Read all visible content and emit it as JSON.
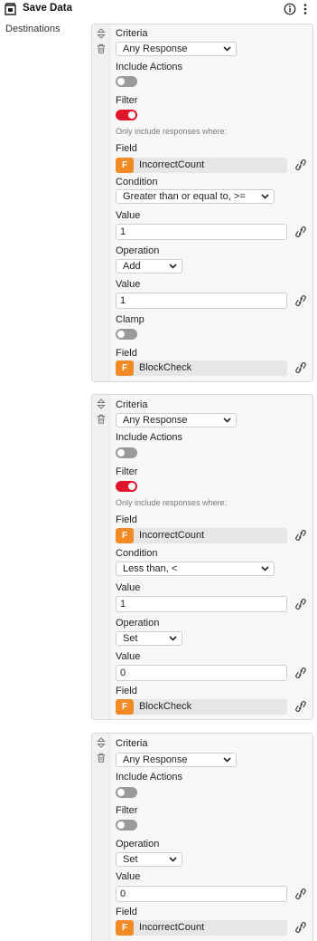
{
  "header": {
    "title": "Save Data",
    "icons": [
      "save-icon",
      "info-icon",
      "more-icon"
    ]
  },
  "destinations_label": "Destinations",
  "labels": {
    "criteria": "Criteria",
    "include_actions": "Include Actions",
    "filter": "Filter",
    "filter_hint": "Only include responses where:",
    "field": "Field",
    "condition": "Condition",
    "value": "Value",
    "operation": "Operation",
    "clamp": "Clamp",
    "field_badge": "F"
  },
  "colors": {
    "accent": "#e0142b",
    "field_badge": "#f28a26",
    "toggle_off": "#9a9a9a"
  },
  "cards": [
    {
      "criteria": "Any Response",
      "include_actions": false,
      "filter": true,
      "filter_field": "IncorrectCount",
      "condition": "Greater than or equal to, >=",
      "condition_value": "1",
      "operation": "Add",
      "operation_value": "1",
      "clamp": false,
      "target_field": "BlockCheck"
    },
    {
      "criteria": "Any Response",
      "include_actions": false,
      "filter": true,
      "filter_field": "IncorrectCount",
      "condition": "Less than, <",
      "condition_value": "1",
      "operation": "Set",
      "operation_value": "0",
      "target_field": "BlockCheck"
    },
    {
      "criteria": "Any Response",
      "include_actions": false,
      "filter": false,
      "operation": "Set",
      "operation_value": "0",
      "target_field": "IncorrectCount"
    }
  ]
}
